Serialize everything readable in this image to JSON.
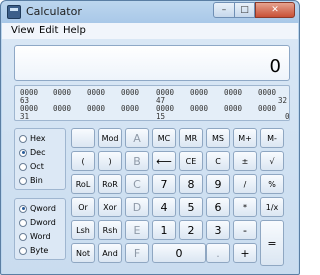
{
  "window": {
    "title": "Calculator",
    "min": "–",
    "max": "□",
    "close": "✕"
  },
  "menu": [
    "View",
    "Edit",
    "Help"
  ],
  "display": {
    "value": "0"
  },
  "bits": {
    "row1": [
      "0000",
      "0000",
      "0000",
      "0000",
      "0000",
      "0000",
      "0000",
      "0000"
    ],
    "row1_labels": [
      "63",
      "47",
      "32"
    ],
    "row2": [
      "0000",
      "0000",
      "0000",
      "0000",
      "0000",
      "0000",
      "0000",
      "0000"
    ],
    "row2_labels": [
      "31",
      "15",
      "0"
    ]
  },
  "radix": {
    "options": [
      "Hex",
      "Dec",
      "Oct",
      "Bin"
    ],
    "selected": "Dec"
  },
  "word_size": {
    "options": [
      "Qword",
      "Dword",
      "Word",
      "Byte"
    ],
    "selected": "Qword"
  },
  "keys": {
    "mod": "Mod",
    "A": "A",
    "MC": "MC",
    "MR": "MR",
    "MS": "MS",
    "Mplus": "M+",
    "Mminus": "M-",
    "lparen": "(",
    "rparen": ")",
    "B": "B",
    "backspace": "⟵",
    "CE": "CE",
    "C": "C",
    "plusminus": "±",
    "sqrt": "√",
    "RoL": "RoL",
    "RoR": "RoR",
    "Ckey": "C",
    "n7": "7",
    "n8": "8",
    "n9": "9",
    "div": "/",
    "pct": "%",
    "Or": "Or",
    "Xor": "Xor",
    "D": "D",
    "n4": "4",
    "n5": "5",
    "n6": "6",
    "mul": "*",
    "recip": "1/x",
    "Lsh": "Lsh",
    "Rsh": "Rsh",
    "E": "E",
    "n1": "1",
    "n2": "2",
    "n3": "3",
    "minus": "-",
    "Not": "Not",
    "And": "And",
    "F": "F",
    "n0": "0",
    "dot": ".",
    "plus": "+",
    "equals": "="
  }
}
